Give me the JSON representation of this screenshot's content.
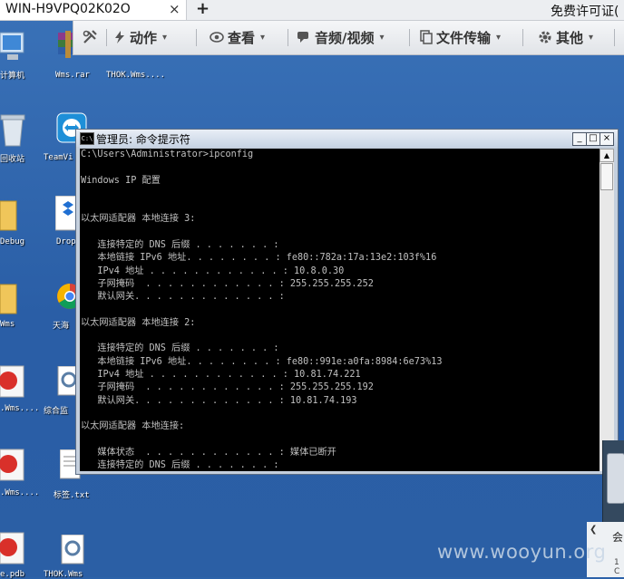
{
  "remote_tab": {
    "title": "WIN-H9VPQ02K02O",
    "close_glyph": "×",
    "add_glyph": "+",
    "right_text": "免费许可证("
  },
  "toolbar": {
    "tools_icon": "tools-icon",
    "action_label": "动作",
    "view_label": "查看",
    "audio_video_label": "音频/视频",
    "file_transfer_label": "文件传输",
    "other_label": "其他",
    "caret": "▾"
  },
  "desktop_icons": [
    {
      "label": "计算机",
      "icon": "computer-icon"
    },
    {
      "label": "Wms.rar",
      "icon": "winrar-icon"
    },
    {
      "label": "THOK.Wms....",
      "icon": "file-icon"
    },
    {
      "label": "回收站",
      "icon": "recycle-bin-icon"
    },
    {
      "label": "TeamVi",
      "icon": "teamviewer-icon"
    },
    {
      "label": "Debug",
      "icon": "folder-icon"
    },
    {
      "label": "Drop",
      "icon": "dropbox-icon"
    },
    {
      "label": "Wms",
      "icon": "folder-icon"
    },
    {
      "label": "天海",
      "icon": "chrome-icon"
    },
    {
      "label": ".Wms....",
      "icon": "app-icon"
    },
    {
      "label": "综合监",
      "icon": "settings-file-icon"
    },
    {
      "label": ".Wms....",
      "icon": "app-icon"
    },
    {
      "label": "标签.txt",
      "icon": "text-file-icon"
    },
    {
      "label": "e.pdb",
      "icon": "app-icon"
    },
    {
      "label": "THOK.Wms",
      "icon": "settings-file-icon"
    }
  ],
  "cmd_window": {
    "title": "管理员: 命令提示符",
    "icon_text": "C:\\",
    "minimize": "_",
    "maximize": "□",
    "close": "×",
    "console_text": "C:\\Users\\Administrator>ipconfig\n\nWindows IP 配置\n\n\n以太网适配器 本地连接 3:\n\n   连接特定的 DNS 后缀 . . . . . . . :\n   本地链接 IPv6 地址. . . . . . . . : fe80::782a:17a:13e2:103f%16\n   IPv4 地址 . . . . . . . . . . . . : 10.8.0.30\n   子网掩码  . . . . . . . . . . . . : 255.255.255.252\n   默认网关. . . . . . . . . . . . . :\n\n以太网适配器 本地连接 2:\n\n   连接特定的 DNS 后缀 . . . . . . . :\n   本地链接 IPv6 地址. . . . . . . . : fe80::991e:a0fa:8984:6e73%13\n   IPv4 地址 . . . . . . . . . . . . : 10.81.74.221\n   子网掩码  . . . . . . . . . . . . : 255.255.255.192\n   默认网关. . . . . . . . . . . . . : 10.81.74.193\n\n以太网适配器 本地连接:\n\n   媒体状态  . . . . . . . . . . . . : 媒体已断开\n   连接特定的 DNS 后缀 . . . . . . . :"
  },
  "side_window": {
    "text": "会",
    "sub_text": "1 C"
  },
  "watermark": "www.wooyun.org"
}
